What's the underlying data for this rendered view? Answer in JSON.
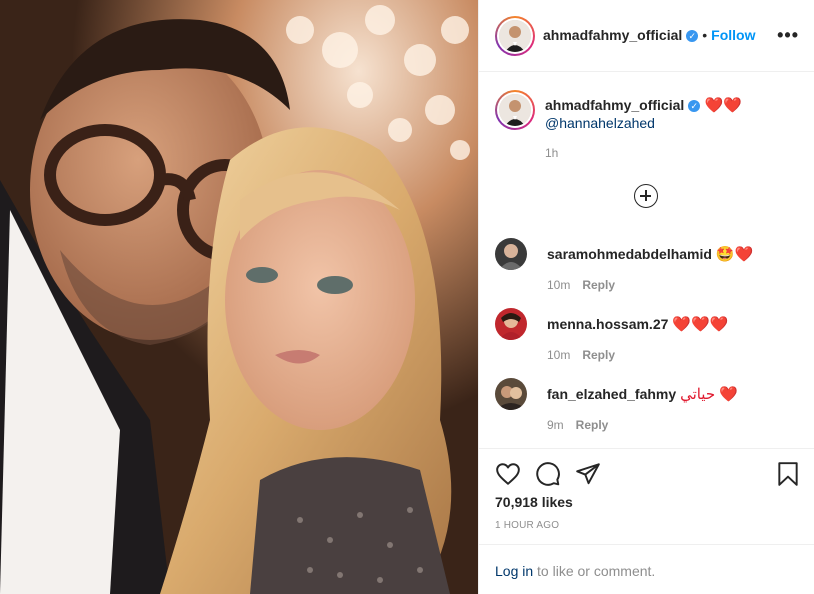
{
  "post": {
    "author": "ahmadfahmy_official",
    "verified_glyph": "✓",
    "separator": "•",
    "follow_label": "Follow",
    "more_label": "•••",
    "photo_alt": "post-photo",
    "caption": {
      "hearts": "❤️❤️",
      "mention": "@hannahelzahed",
      "time": "1h"
    },
    "load_more_icon": "plus-circle-icon"
  },
  "comments": [
    {
      "username": "saramohmedabdelhamid",
      "text": "🤩❤️",
      "time": "10m",
      "reply_label": "Reply"
    },
    {
      "username": "menna.hossam.27",
      "text": "❤️❤️❤️",
      "time": "10m",
      "reply_label": "Reply"
    },
    {
      "username": "fan_elzahed_fahmy",
      "text": "حياتي ❤️",
      "time": "9m",
      "reply_label": "Reply"
    }
  ],
  "actions": {
    "icons": [
      "heart-icon",
      "comment-icon",
      "share-icon",
      "bookmark-icon"
    ],
    "likes": "70,918 likes",
    "posted": "1 HOUR AGO"
  },
  "footer": {
    "login_link": "Log in",
    "login_rest": " to like or comment."
  },
  "colors": {
    "accent": "#0095f6",
    "heart": "#e0182d",
    "muted": "#8e8e8e",
    "border": "#efefef"
  }
}
